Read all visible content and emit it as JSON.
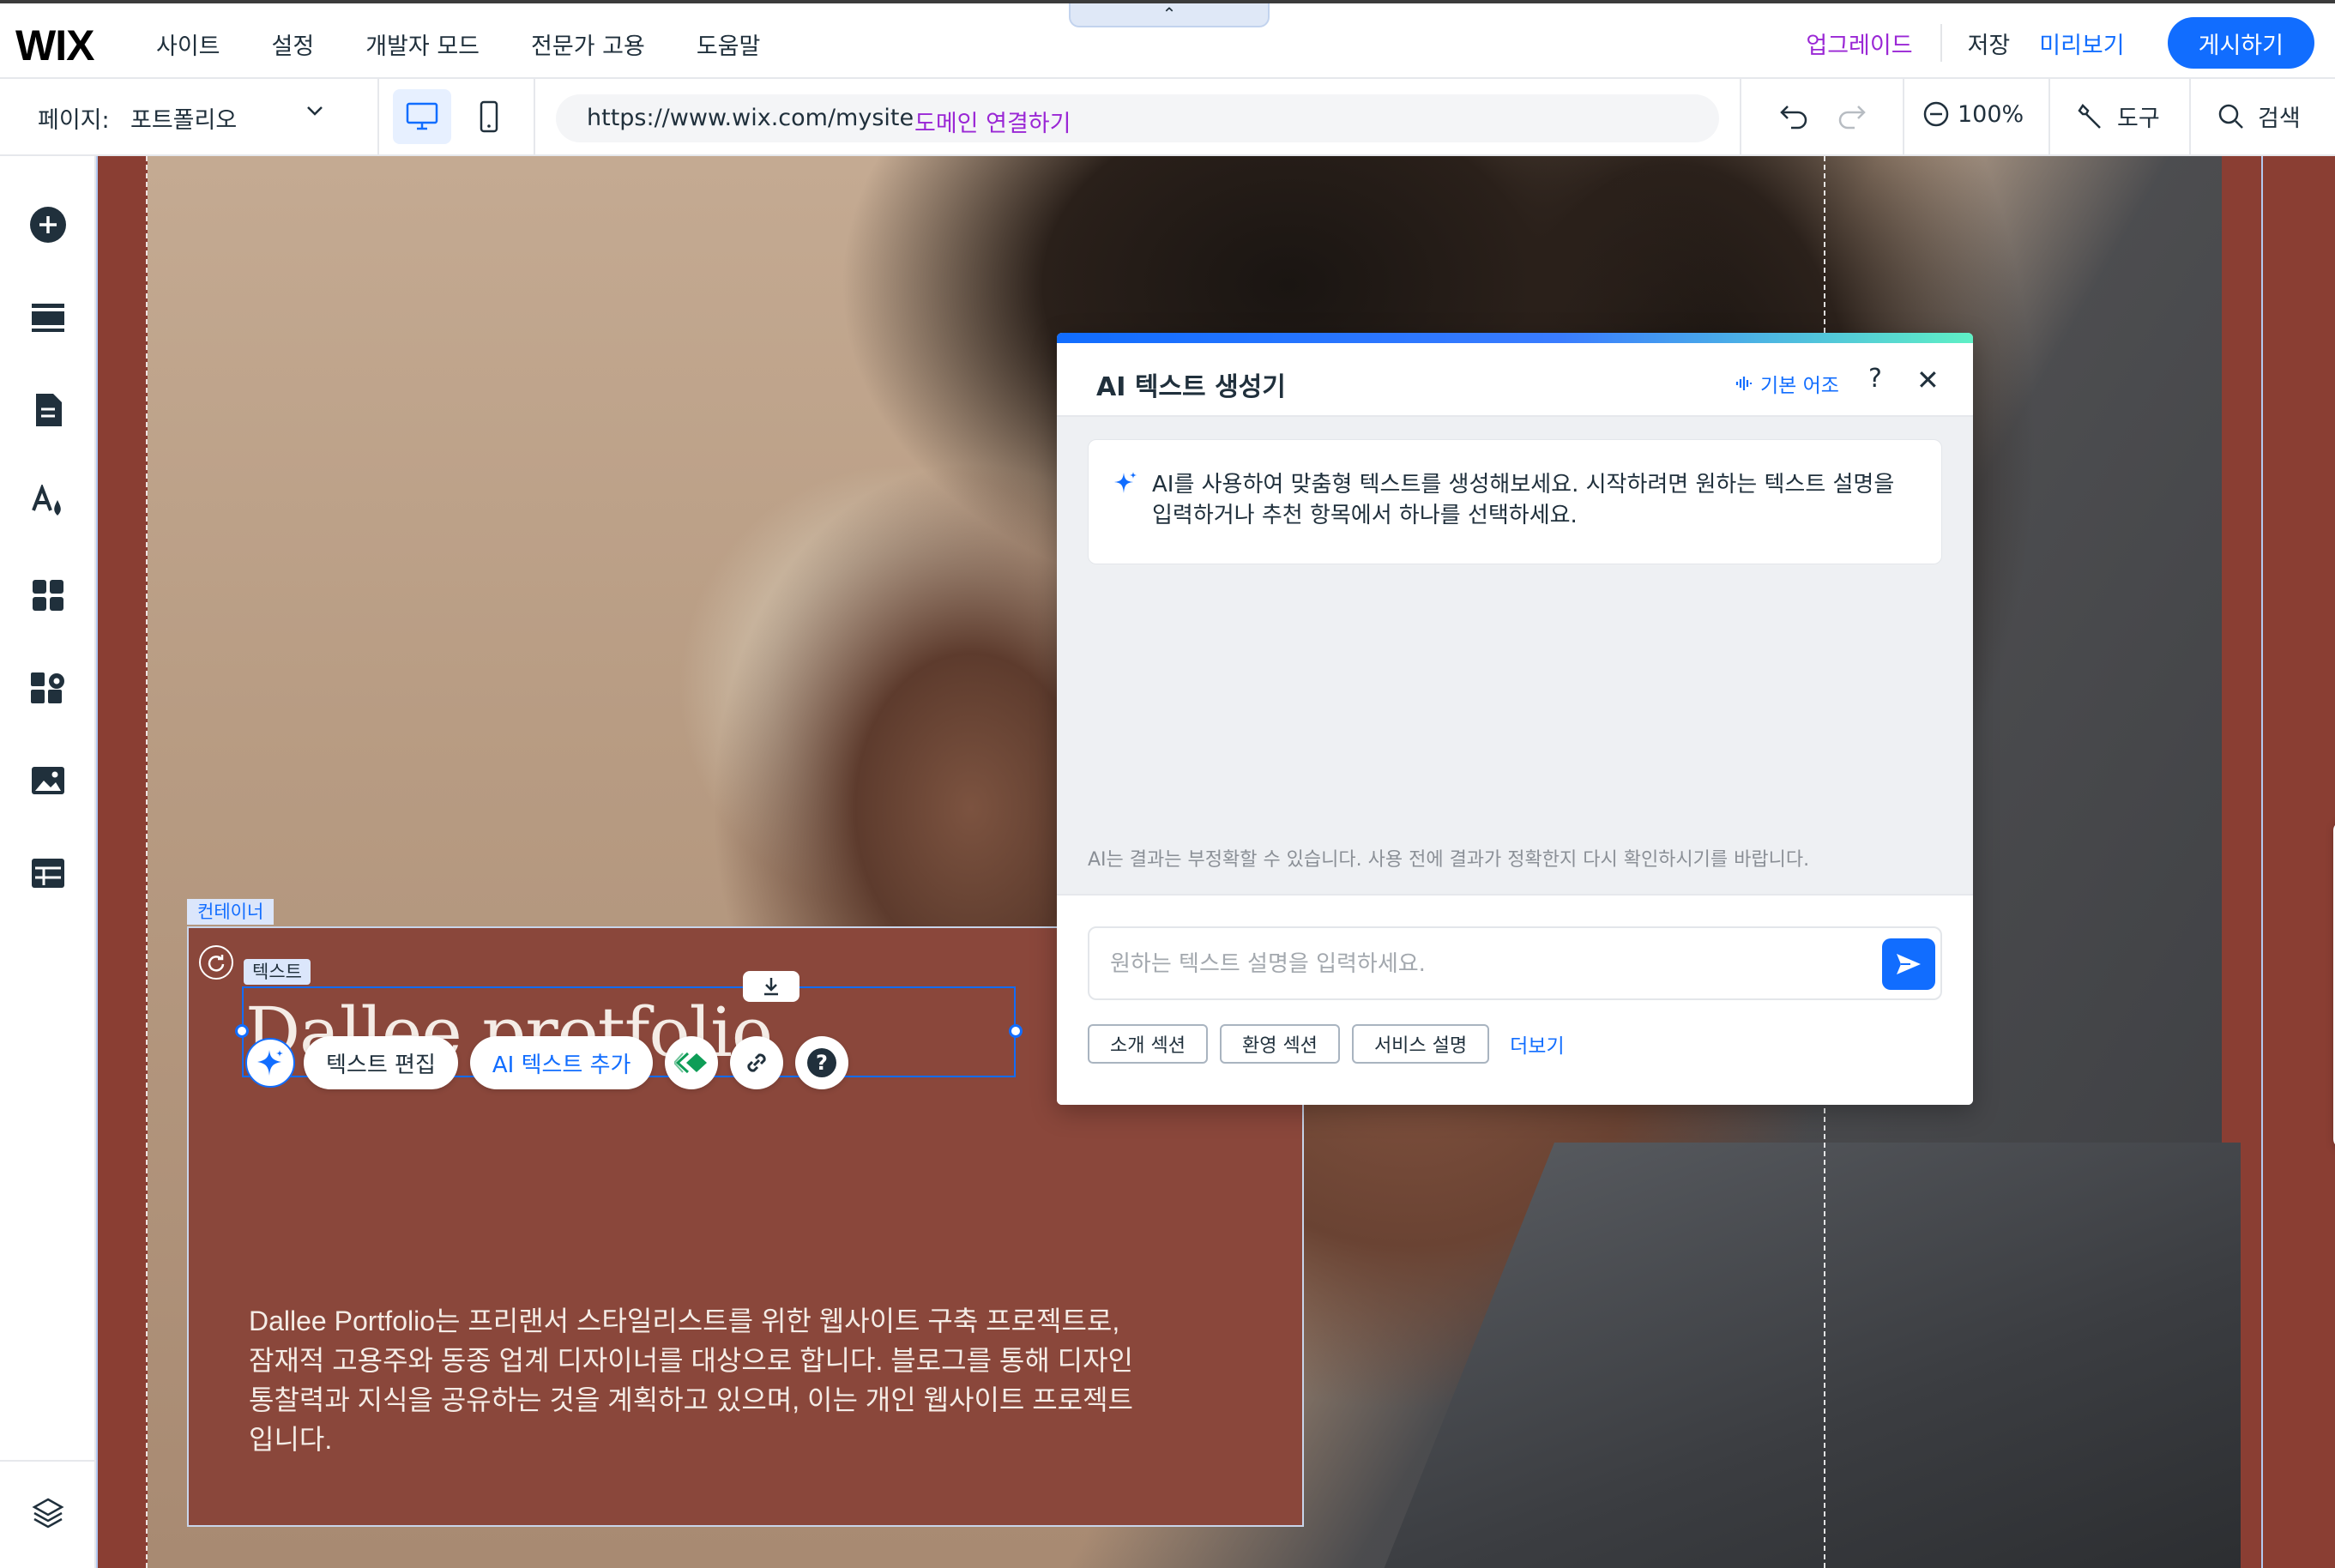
{
  "topbar": {
    "logo": "WIX",
    "menu": [
      "사이트",
      "설정",
      "개발자 모드",
      "전문가 고용",
      "도움말"
    ],
    "collapse_glyph": "⌃",
    "upgrade": "업그레이드",
    "save": "저장",
    "preview": "미리보기",
    "publish": "게시하기"
  },
  "secondbar": {
    "page_label": "페이지:",
    "page_value": "포트폴리오",
    "url": "https://www.wix.com/mysite",
    "domain_link": "도메인 연결하기",
    "zoom": "100%",
    "tools": "도구",
    "search": "검색"
  },
  "leftrail": {
    "icons": [
      "add-icon",
      "sections-icon",
      "pages-icon",
      "design-icon",
      "apps-icon",
      "business-icon",
      "media-icon",
      "table-icon",
      "layers-icon"
    ]
  },
  "canvas": {
    "container_tag": "컨테이너",
    "text_tag": "텍스트",
    "title": "Dallee protfolio",
    "body": "Dallee Portfolio는 프리랜서 스타일리스트를 위한 웹사이트 구축 프로젝트로, 잠재적 고용주와 동종 업계 디자이너를 대상으로 합니다. 블로그를 통해 디자인 통찰력과 지식을 공유하는 것을 계획하고 있으며, 이는 개인 웹사이트 프로젝트입니다.",
    "toolbar": {
      "edit_text": "텍스트 편집",
      "ai_add": "AI 텍스트 추가"
    }
  },
  "ai_panel": {
    "title": "AI 텍스트 생성기",
    "tone": "기본 어조",
    "help": "?",
    "close": "✕",
    "intro": "AI를 사용하여 맞춤형 텍스트를 생성해보세요. 시작하려면 원하는 텍스트 설명을 입력하거나 추천 항목에서 하나를 선택하세요.",
    "disclaimer": "AI는 결과는 부정확할 수 있습니다. 사용 전에 결과가 정확한지 다시 확인하시기를 바랍니다.",
    "input_placeholder": "원하는 텍스트 설명을 입력하세요.",
    "chips": [
      "소개 섹션",
      "환영 섹션",
      "서비스 설명"
    ],
    "more": "더보기"
  },
  "colors": {
    "accent": "#116dff",
    "upgrade": "#9a27d5",
    "section_bg": "#8a473b"
  }
}
